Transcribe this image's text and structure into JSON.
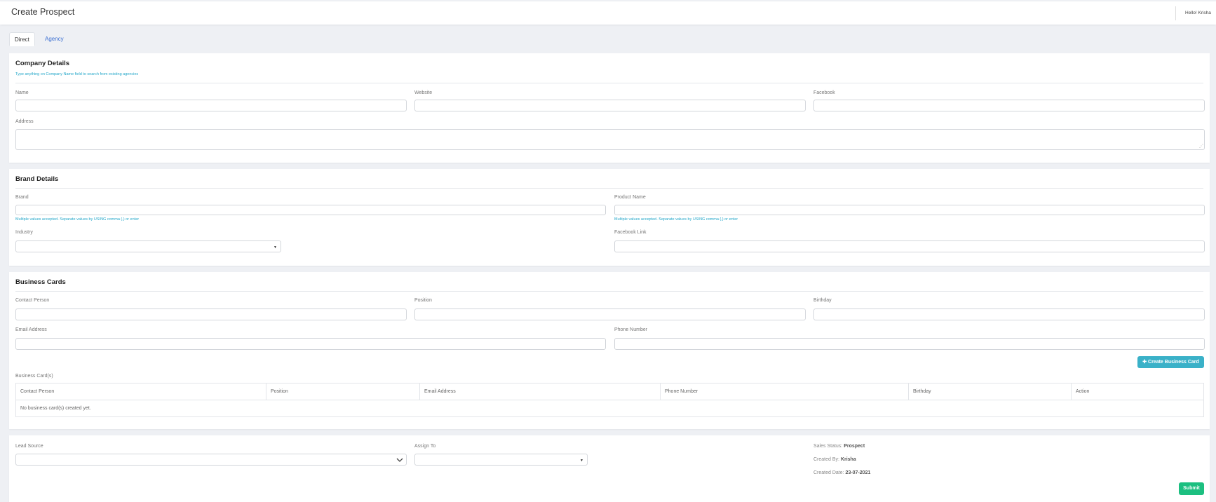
{
  "header": {
    "title": "Create Prospect",
    "greeting": "Hello! Krisha"
  },
  "tabs": [
    {
      "label": "Direct",
      "active": true
    },
    {
      "label": "Agency",
      "active": false
    }
  ],
  "company": {
    "title": "Company Details",
    "hint": "Type anything on Company Name field to search from existing agencies",
    "name_label": "Name",
    "name_value": "",
    "website_label": "Website",
    "website_value": "",
    "facebook_label": "Facebook",
    "facebook_value": "",
    "address_label": "Address",
    "address_value": ""
  },
  "brand": {
    "title": "Brand Details",
    "brand_label": "Brand",
    "brand_value": "",
    "brand_hint": "Multiple values accepted. Separate values by USING comma (,) or enter",
    "product_label": "Product Name",
    "product_value": "",
    "product_hint": "Multiple values accepted. Separate values by USING comma (,) or enter",
    "industry_label": "Industry",
    "industry_value": "",
    "facebook_link_label": "Facebook Link",
    "facebook_link_value": ""
  },
  "business_cards": {
    "title": "Business Cards",
    "contact_label": "Contact Person",
    "position_label": "Position",
    "birthday_label": "Birthday",
    "email_label": "Email Address",
    "phone_label": "Phone Number",
    "create_button": "Create Business Card",
    "list_label": "Business Card(s)",
    "columns": [
      "Contact Person",
      "Position",
      "Email Address",
      "Phone Number",
      "Birthday",
      "Action"
    ],
    "empty_text": "No business card(s) created yet."
  },
  "footer": {
    "lead_source_label": "Lead Source",
    "lead_source_value": "",
    "assign_to_label": "Assign To",
    "assign_to_value": "",
    "sales_status_label": "Sales Status:",
    "sales_status_value": "Prospect",
    "created_by_label": "Created By:",
    "created_by_value": "Krisha",
    "created_date_label": "Created Date:",
    "created_date_value": "23-07-2021",
    "submit_label": "Submit"
  },
  "colors": {
    "accent_info": "#3ab1c8",
    "accent_success": "#1cbf80",
    "link": "#3b6fd2",
    "hint": "#23a7c9"
  }
}
